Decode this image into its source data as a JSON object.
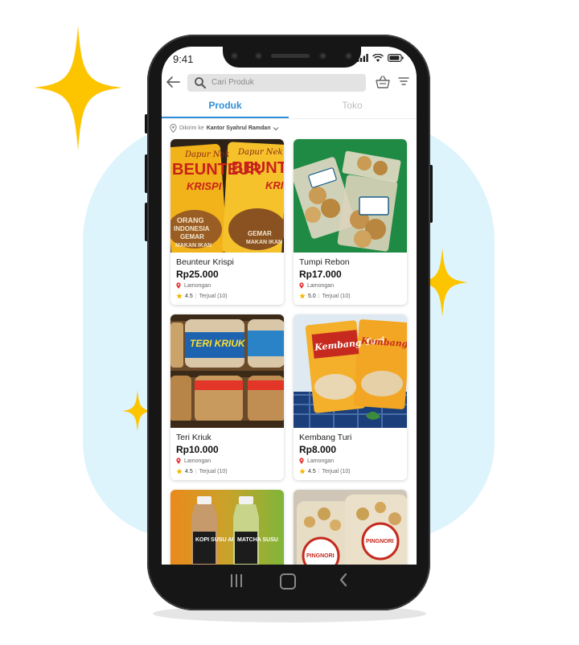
{
  "status_bar": {
    "time": "9:41"
  },
  "search": {
    "placeholder": "Cari Produk"
  },
  "tabs": [
    {
      "label": "Produk",
      "active": true
    },
    {
      "label": "Toko",
      "active": false
    }
  ],
  "delivery": {
    "prefix": "Dikirim ke",
    "location": "Kantor Syahrul Ramdan"
  },
  "products": [
    {
      "name": "Beunteur Krispi",
      "price": "Rp25.000",
      "city": "Lamongan",
      "rating": "4.5",
      "sold": "Terjual (10)"
    },
    {
      "name": "Tumpi Rebon",
      "price": "Rp17.000",
      "city": "Lamongan",
      "rating": "5.0",
      "sold": "Terjual (10)"
    },
    {
      "name": "Teri Kriuk",
      "price": "Rp10.000",
      "city": "Lamongan",
      "rating": "4.5",
      "sold": "Terjual (10)"
    },
    {
      "name": "Kembang Turi",
      "price": "Rp8.000",
      "city": "Lamongan",
      "rating": "4.5",
      "sold": "Terjual (10)"
    },
    {
      "name": "",
      "price": "",
      "city": "",
      "rating": "",
      "sold": ""
    },
    {
      "name": "",
      "price": "",
      "city": "",
      "rating": "",
      "sold": ""
    }
  ],
  "product_images": {
    "p1": {
      "brand": "Dapur Nek",
      "title1": "BEUNTEUR",
      "title2": "KRISPI",
      "line1": "ORANG",
      "line2": "INDONESIA",
      "line3": "GEMAR",
      "line4": "MAKAN IKAN"
    },
    "p3": {
      "title": "TERI KRIUK"
    },
    "p4": {
      "title": "Kembang Turi"
    },
    "p5": {
      "left": "KOPI SUSU AREN",
      "right": "MATCHA SUSU"
    },
    "p6": {
      "brand": "PINGNORI"
    }
  },
  "colors": {
    "accent": "#2f8ed8",
    "star": "#f5b800",
    "location_pin": "#e53935",
    "sparkle": "#fdc500",
    "blob": "#def4fc"
  }
}
